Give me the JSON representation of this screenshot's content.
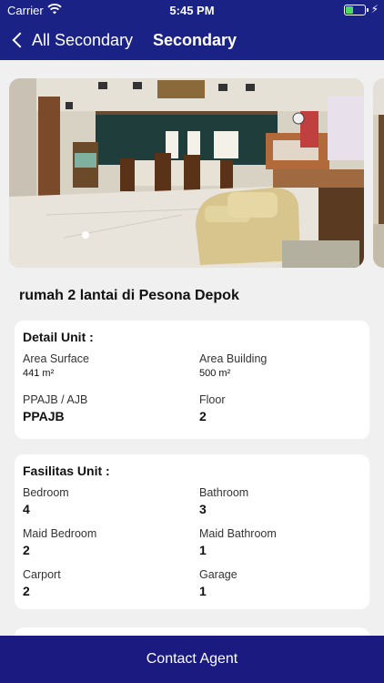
{
  "status": {
    "carrier": "Carrier",
    "time": "5:45 PM"
  },
  "nav": {
    "back_label": "All Secondary",
    "title": "Secondary"
  },
  "listing": {
    "title": "rumah 2 lantai di Pesona Depok"
  },
  "detail": {
    "heading": "Detail Unit :",
    "area_surface_label": "Area Surface",
    "area_surface_value": "441 m²",
    "area_building_label": "Area Building",
    "area_building_value": "500 m²",
    "ppajb_label": "PPAJB / AJB",
    "ppajb_value": "PPAJB",
    "floor_label": "Floor",
    "floor_value": "2"
  },
  "facilities": {
    "heading": "Fasilitas Unit :",
    "bedroom_label": "Bedroom",
    "bedroom_value": "4",
    "bathroom_label": "Bathroom",
    "bathroom_value": "3",
    "maid_bedroom_label": "Maid Bedroom",
    "maid_bedroom_value": "2",
    "maid_bathroom_label": "Maid Bathroom",
    "maid_bathroom_value": "1",
    "carport_label": "Carport",
    "carport_value": "2",
    "garage_label": "Garage",
    "garage_value": "1"
  },
  "action": {
    "contact_label": "Contact Agent"
  }
}
